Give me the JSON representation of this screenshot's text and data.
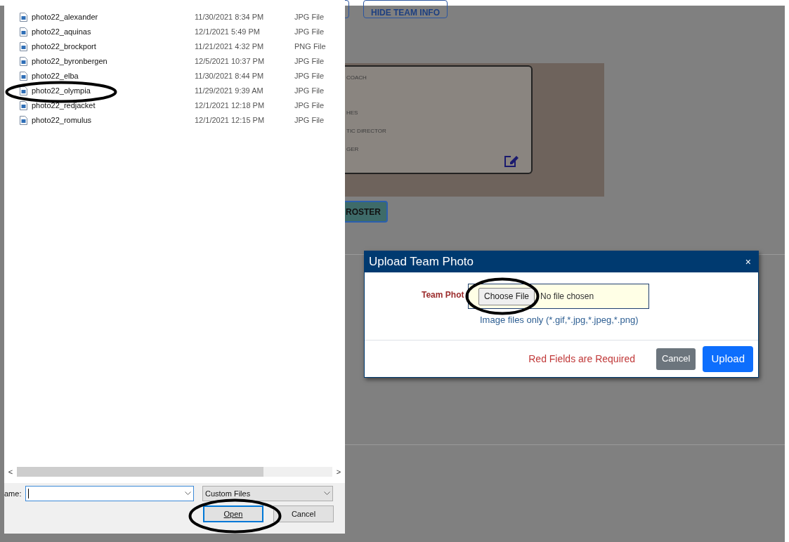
{
  "file_dialog": {
    "files": [
      {
        "name": "photo22_alexander",
        "date": "11/30/2021 8:34 PM",
        "type": "JPG File"
      },
      {
        "name": "photo22_aquinas",
        "date": "12/1/2021 5:49 PM",
        "type": "JPG File"
      },
      {
        "name": "photo22_brockport",
        "date": "11/21/2021 4:32 PM",
        "type": "PNG File"
      },
      {
        "name": "photo22_byronbergen",
        "date": "12/5/2021 10:37 PM",
        "type": "JPG File"
      },
      {
        "name": "photo22_elba",
        "date": "11/30/2021 8:44 PM",
        "type": "JPG File"
      },
      {
        "name": "photo22_olympia",
        "date": "11/29/2021 9:39 AM",
        "type": "JPG File"
      },
      {
        "name": "photo22_redjacket",
        "date": "12/1/2021 12:18 PM",
        "type": "JPG File"
      },
      {
        "name": "photo22_romulus",
        "date": "12/1/2021 12:15 PM",
        "type": "JPG File"
      }
    ],
    "scroll_left": "<",
    "scroll_right": ">",
    "file_name_label": "ame:",
    "file_type": "Custom Files",
    "open_button": "Open",
    "cancel_button": "Cancel"
  },
  "page": {
    "top_button": "HIDE TEAM INFO",
    "team_card_lines": [
      "COACH",
      "HES",
      "TIC DIRECTOR",
      "GER"
    ],
    "roster_button": "ROSTER"
  },
  "modal": {
    "title": "Upload Team Photo",
    "close": "×",
    "field_label": "Team Phot",
    "choose_button": "Choose File",
    "file_status": "No file chosen",
    "hint": "Image files only (*.gif,*.jpg,*.jpeg,*.png)",
    "required_note": "Red Fields are Required",
    "cancel_button": "Cancel",
    "upload_button": "Upload"
  }
}
